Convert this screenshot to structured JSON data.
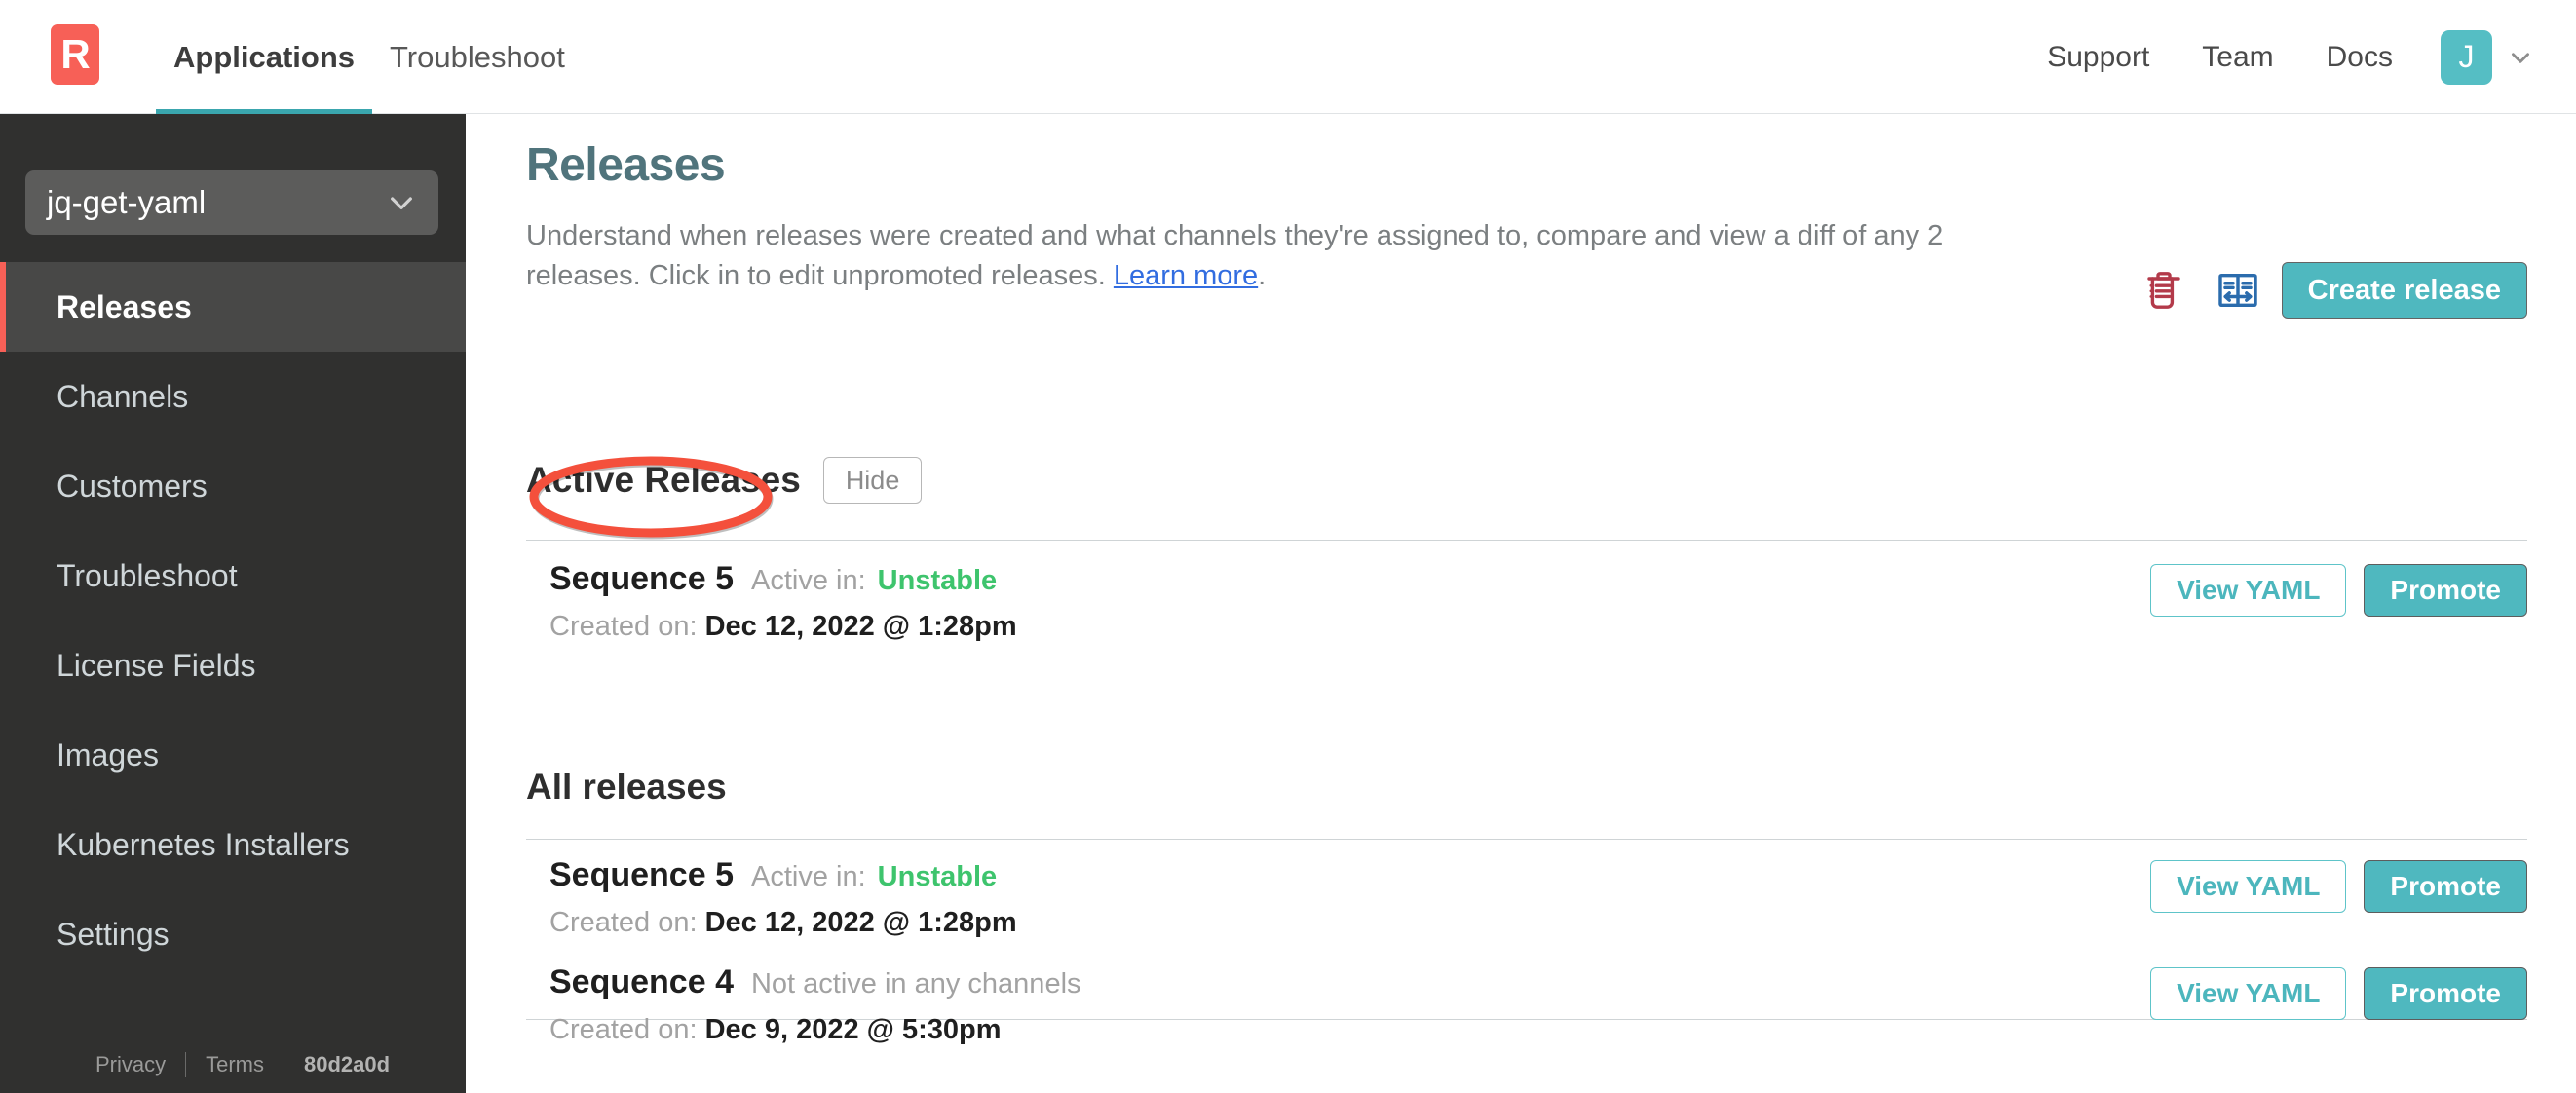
{
  "topnav": {
    "logo_letter": "R",
    "tabs": [
      {
        "label": "Applications",
        "active": true
      },
      {
        "label": "Troubleshoot",
        "active": false
      }
    ],
    "links": [
      "Support",
      "Team",
      "Docs"
    ],
    "link_support": "Support",
    "link_team": "Team",
    "link_docs": "Docs",
    "avatar_initial": "J"
  },
  "sidebar": {
    "app_selector_value": "jq-get-yaml",
    "items": [
      {
        "label": "Releases",
        "active": true
      },
      {
        "label": "Channels",
        "active": false
      },
      {
        "label": "Customers",
        "active": false
      },
      {
        "label": "Troubleshoot",
        "active": false
      },
      {
        "label": "License Fields",
        "active": false
      },
      {
        "label": "Images",
        "active": false
      },
      {
        "label": "Kubernetes Installers",
        "active": false
      },
      {
        "label": "Settings",
        "active": false
      }
    ],
    "footer": {
      "privacy": "Privacy",
      "terms": "Terms",
      "commit": "80d2a0d"
    }
  },
  "main": {
    "title": "Releases",
    "description_part1": "Understand when releases were created and what channels they're assigned to, compare and view a diff of any 2 releases. Click in to edit unpromoted releases. ",
    "description_link": "Learn more",
    "description_part2": ".",
    "create_release_label": "Create release",
    "active_section": {
      "title": "Active Releases",
      "toggle_label": "Hide"
    },
    "all_section": {
      "title": "All releases"
    },
    "active_releases": [
      {
        "sequence": "Sequence 5",
        "active_label": "Active in:",
        "channel": "Unstable",
        "created_label": "Created on:",
        "created_value": "Dec 12, 2022 @ 1:28pm",
        "view_yaml_label": "View YAML",
        "promote_label": "Promote"
      }
    ],
    "all_releases": [
      {
        "sequence": "Sequence 5",
        "active_label": "Active in:",
        "channel": "Unstable",
        "not_active": "",
        "created_label": "Created on:",
        "created_value": "Dec 12, 2022 @ 1:28pm",
        "view_yaml_label": "View YAML",
        "promote_label": "Promote"
      },
      {
        "sequence": "Sequence 4",
        "active_label": "",
        "channel": "",
        "not_active": "Not active in any channels",
        "created_label": "Created on:",
        "created_value": "Dec 9, 2022 @ 5:30pm",
        "view_yaml_label": "View YAML",
        "promote_label": "Promote"
      }
    ]
  },
  "annotation": {
    "shape": "ellipse",
    "color": "#f4503c",
    "target": "Sequence 5"
  },
  "colors": {
    "brand_red": "#f76057",
    "teal": "#4fb8bf",
    "title_blue_gray": "#50747c",
    "channel_green": "#3ec46d",
    "link_blue": "#326de0",
    "sidebar_bg": "#30302f"
  }
}
